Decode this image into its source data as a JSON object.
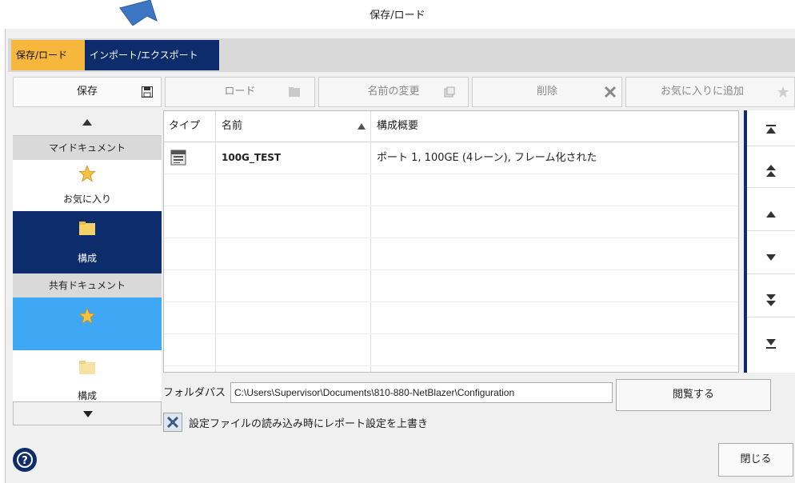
{
  "window": {
    "title": "保存/ロード"
  },
  "tabs": [
    {
      "label": "保存/ロード",
      "active": true
    },
    {
      "label": "インポート/エクスポート",
      "active": false
    }
  ],
  "toolbar": {
    "save": "保存",
    "load": "ロード",
    "rename": "名前の変更",
    "delete": "削除",
    "add_favorite": "お気に入りに追加"
  },
  "sidebar": {
    "my_documents": "マイドキュメント",
    "favorites": "お気に入り",
    "config": "構成",
    "shared_documents": "共有ドキュメント",
    "shared_config": "構成"
  },
  "table": {
    "headers": {
      "type": "タイプ",
      "name": "名前",
      "summary": "構成概要"
    },
    "rows": [
      {
        "name": "100G_TEST",
        "summary": "ポート 1, 100GE (4レーン), フレーム化された"
      }
    ]
  },
  "folder": {
    "label": "フォルダパス",
    "path": "C:\\Users\\Supervisor\\Documents\\810-880-NetBlazer\\Configuration",
    "browse": "閲覧する"
  },
  "checkbox": {
    "label": "設定ファイルの読み込み時にレポート設定を上書き",
    "checked": true
  },
  "footer": {
    "close": "閉じる",
    "help_glyph": "?"
  },
  "colors": {
    "navy": "#0d2c6c",
    "orange": "#f6b73c",
    "sky": "#3ea8f4",
    "folder": "#f3d26a",
    "star": "#f5c242"
  }
}
